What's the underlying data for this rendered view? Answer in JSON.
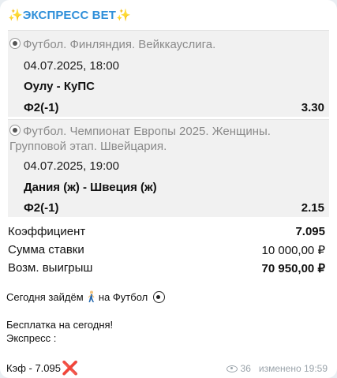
{
  "header": {
    "sparkle_left": "✨",
    "title": "ЭКСПРЕСС ВЕТ",
    "sparkle_right": "✨"
  },
  "bets": [
    {
      "league": "Футбол. Финляндия. Вейккауслига.",
      "datetime": "04.07.2025, 18:00",
      "match": "Оулу - КуПС",
      "market": "Ф2(-1)",
      "odds": "3.30"
    },
    {
      "league_line1": "Футбол. Чемпионат Европы 2025. Женщины.",
      "league_line2": "Групповой этап. Швейцария.",
      "datetime": "04.07.2025, 19:00",
      "match": "Дания (ж) - Швеция (ж)",
      "market": "Ф2(-1)",
      "odds": "2.15"
    }
  ],
  "summary": {
    "coef_label": "Коэффициент",
    "coef_value": "7.095",
    "stake_label": "Сумма ставки",
    "stake_value": "10 000,00 ₽",
    "win_label": "Возм. выигрыш",
    "win_value": "70 950,00 ₽"
  },
  "message": {
    "line1_a": "Сегодня зайдём",
    "line1_b": "на Футбол",
    "line2": "Бесплатка на сегодня!",
    "line3": "Экспресс :",
    "line4": "Кэф - 7.095",
    "cross": "❌"
  },
  "meta": {
    "views": "36",
    "edited": "изменено 19:59"
  },
  "icons": {
    "league": "soccer-ball-icon",
    "runner": "runner-emoji-icon",
    "soccer": "soccer-ball-emoji-icon",
    "views": "eye-icon"
  }
}
